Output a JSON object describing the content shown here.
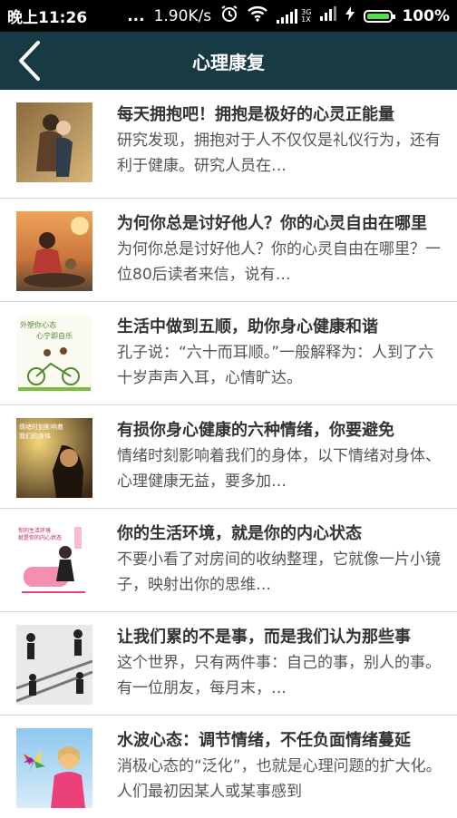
{
  "status": {
    "time": "晚上11:26",
    "dots": "...",
    "speed": "1.90K/s",
    "net_label_top": "3G",
    "net_label_bottom": "1X",
    "battery": "100%"
  },
  "header": {
    "title": "心理康复",
    "back_icon": "chevron-left-icon"
  },
  "items": [
    {
      "title": "每天拥抱吧！拥抱是极好的心灵正能量",
      "desc": "研究发现，拥抱对于人不仅仅是礼仪行为，还有利于健康。研究人员在…"
    },
    {
      "title": "为何你总是讨好他人？你的心灵自由在哪里",
      "desc": "为何你总是讨好他人？你的心灵自由在哪里？一位80后读者来信，说有…"
    },
    {
      "title": "生活中做到五顺，助你身心健康和谐",
      "desc": "孔子说：“六十而耳顺。”一般解释为：人到了六十岁声声入耳，心情旷达。"
    },
    {
      "title": "有损你身心健康的六种情绪，你要避免",
      "desc": "情绪时刻影响着我们的身体，以下情绪对身体、心理健康无益，要多加…"
    },
    {
      "title": "你的生活环境，就是你的内心状态",
      "desc": "不要小看了对房间的收纳整理，它就像一片小镜子，映射出你的思维…"
    },
    {
      "title": "让我们累的不是事，而是我们认为那些事",
      "desc": "这个世界，只有两件事：自己的事，别人的事。有一位朋友，每月末，…"
    },
    {
      "title": "水波心态：调节情绪，不任负面情绪蔓延",
      "desc": "消极心态的“泛化”，也就是心理问题的扩大化。人们最初因某人或某事感到"
    }
  ],
  "thumbs": [
    {
      "caption": ""
    },
    {
      "caption": ""
    },
    {
      "caption_line1": "外塑你心态",
      "caption_line2": "心宁即自乐"
    },
    {
      "caption_line1": "情绪时刻影响着",
      "caption_line2": "我们的身体"
    },
    {
      "caption_line1": "你的生活环境",
      "caption_line2": "就是你的内心状态"
    },
    {
      "caption": ""
    },
    {
      "caption": ""
    }
  ]
}
